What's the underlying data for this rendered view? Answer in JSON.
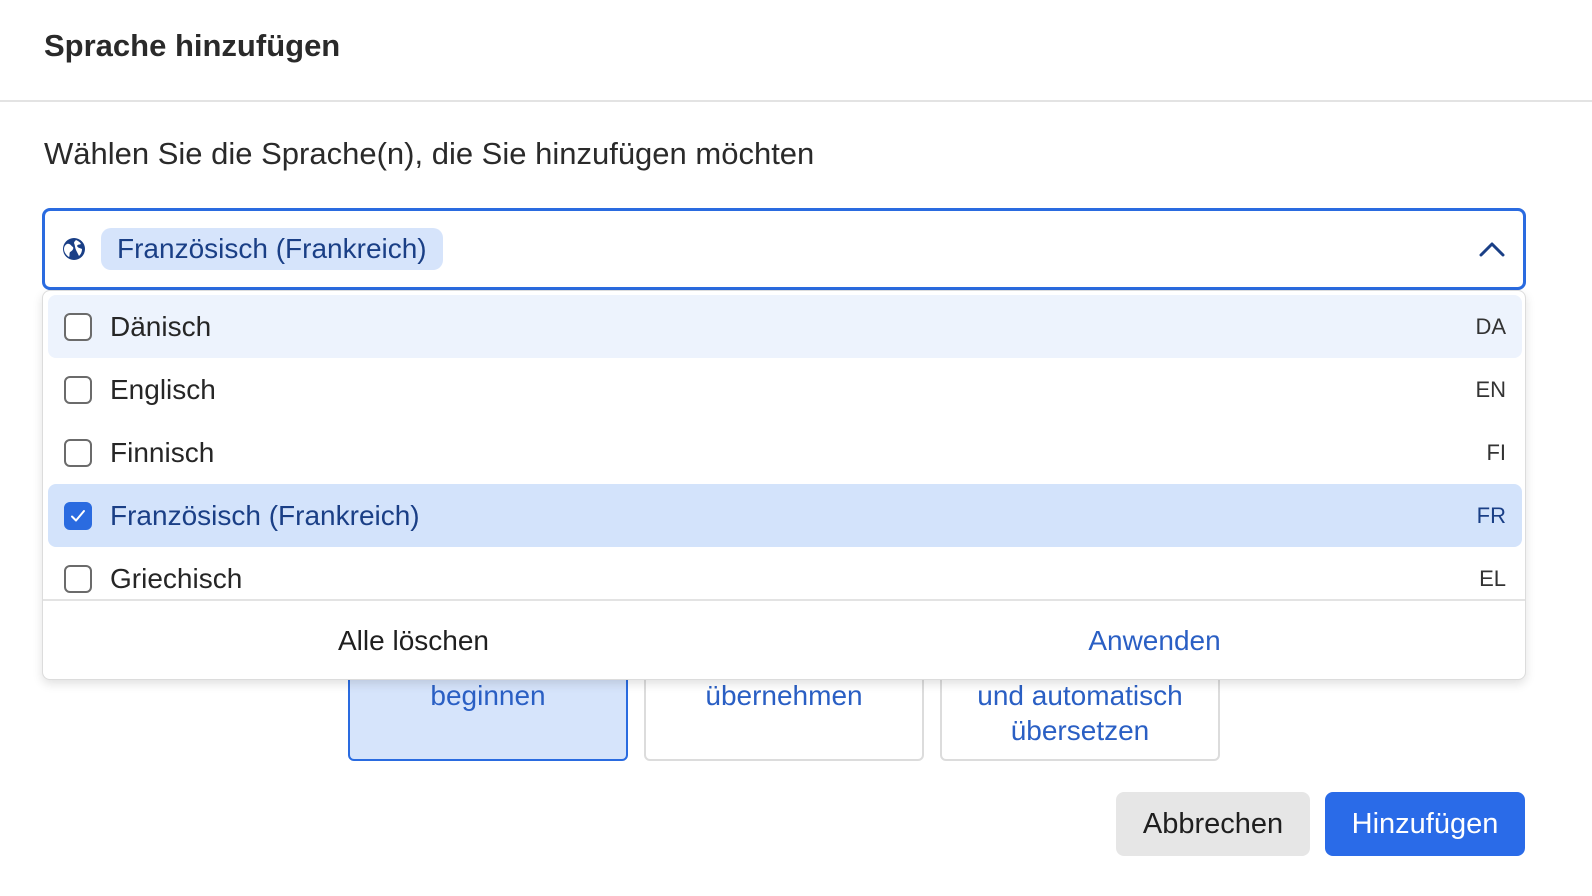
{
  "dialog": {
    "title": "Sprache hinzufügen",
    "prompt": "Wählen Sie die Sprache(n), die Sie hinzufügen möchten"
  },
  "select": {
    "icon": "globe-icon",
    "selected_chip": "Französisch (Frankreich)",
    "expanded": true
  },
  "options": [
    {
      "label": "Dänisch",
      "code": "DA",
      "checked": false,
      "state": "hover"
    },
    {
      "label": "Englisch",
      "code": "EN",
      "checked": false,
      "state": ""
    },
    {
      "label": "Finnisch",
      "code": "FI",
      "checked": false,
      "state": ""
    },
    {
      "label": "Französisch (Frankreich)",
      "code": "FR",
      "checked": true,
      "state": "selected"
    },
    {
      "label": "Griechisch",
      "code": "EL",
      "checked": false,
      "state": ""
    }
  ],
  "dropdown_footer": {
    "clear_label": "Alle löschen",
    "apply_label": "Anwenden"
  },
  "cards": [
    {
      "line1": "beginnen",
      "line2": "",
      "active": true
    },
    {
      "line1": "übernehmen",
      "line2": "",
      "active": false
    },
    {
      "line1": "und automatisch",
      "line2": "übersetzen",
      "active": false
    }
  ],
  "actions": {
    "cancel_label": "Abbrechen",
    "add_label": "Hinzufügen"
  },
  "colors": {
    "accent": "#2a6be0",
    "chip_bg": "#d6e4fb",
    "primary_button": "#2a6be8"
  }
}
